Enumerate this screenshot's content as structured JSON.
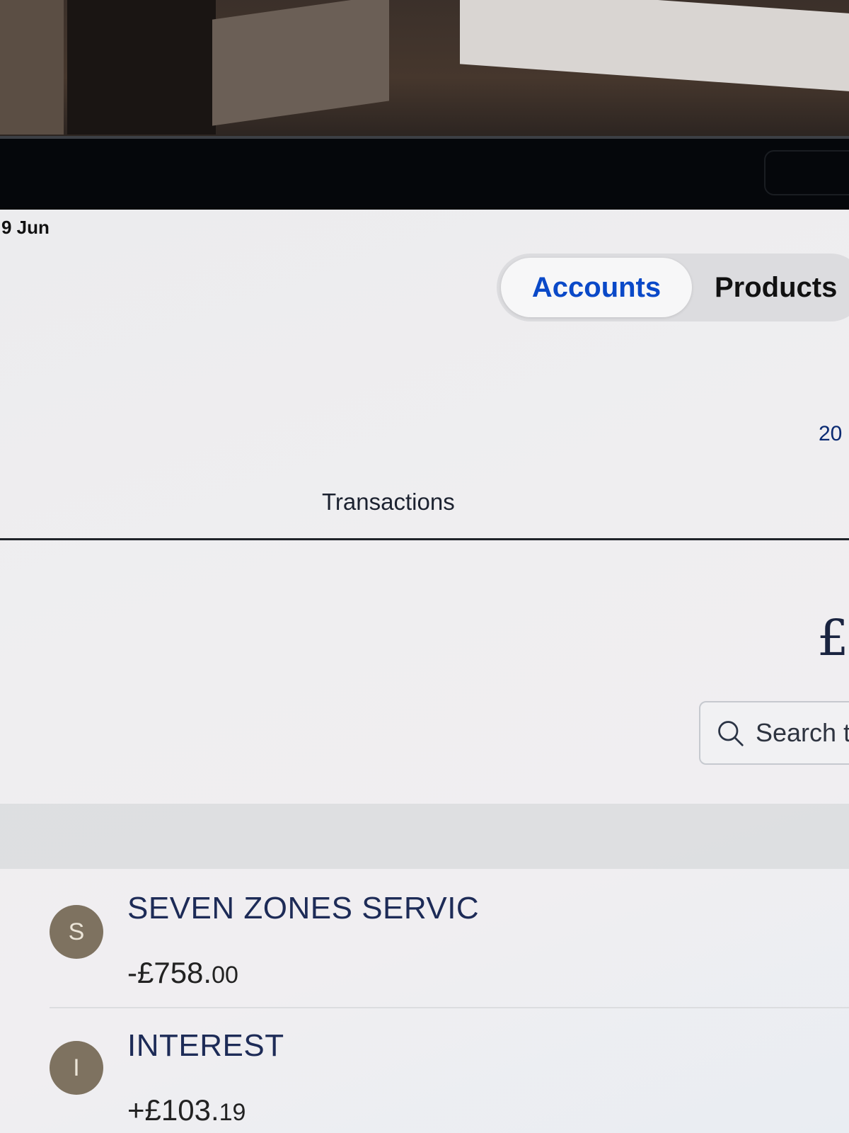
{
  "status_bar": {
    "time": "9 Jun"
  },
  "segmented_control": {
    "tabs": [
      {
        "label": "Accounts",
        "selected": true
      },
      {
        "label": "Products",
        "selected": false
      }
    ]
  },
  "header": {
    "date_fragment": "20"
  },
  "section": {
    "title": "Transactions"
  },
  "search": {
    "placeholder": "Search t"
  },
  "transactions": [
    {
      "initial": "S",
      "name": "SEVEN ZONES SERVIC",
      "amount_main": "-£758.",
      "amount_pence": "00"
    },
    {
      "initial": "I",
      "name": "INTEREST",
      "amount_main": "+£103.",
      "amount_pence": "19"
    }
  ],
  "colors": {
    "accent": "#0a49c8",
    "merchant_text": "#1d2b57",
    "avatar_bg": "#7e7260"
  },
  "icons": {
    "currency": "pound-sign-icon",
    "search": "search-icon"
  }
}
